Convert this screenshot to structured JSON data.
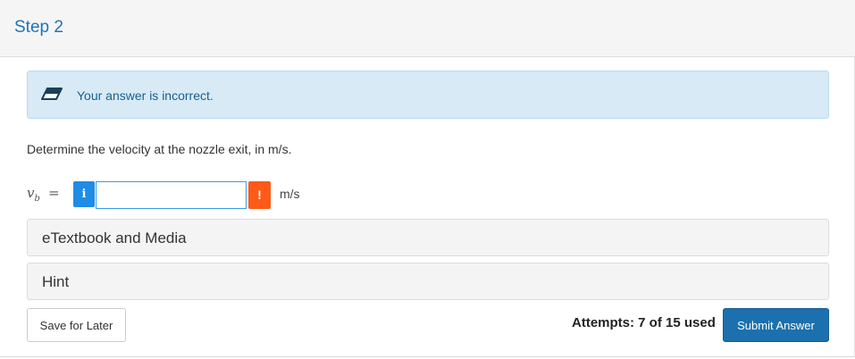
{
  "header": {
    "title": "Step 2"
  },
  "alert": {
    "icon": "eraser-icon",
    "message": "Your answer is incorrect.",
    "background": "#d7eaf6",
    "text_color": "#1a5f8c"
  },
  "question": {
    "text": "Determine the velocity at the nozzle exit, in m/s."
  },
  "answer": {
    "variable": "v",
    "subscript": "b",
    "equals": "=",
    "info_icon_glyph": "i",
    "input_value": "",
    "warning_icon_glyph": "!",
    "unit": "m/s"
  },
  "accordions": [
    {
      "label": "eTextbook and Media"
    },
    {
      "label": "Hint"
    }
  ],
  "footer": {
    "save_label": "Save for Later",
    "attempts_text": "Attempts: 7 of 15 used",
    "submit_label": "Submit Answer"
  },
  "colors": {
    "accent": "#1c70ae",
    "info": "#1f8ce6",
    "warning": "#ff5a16"
  }
}
